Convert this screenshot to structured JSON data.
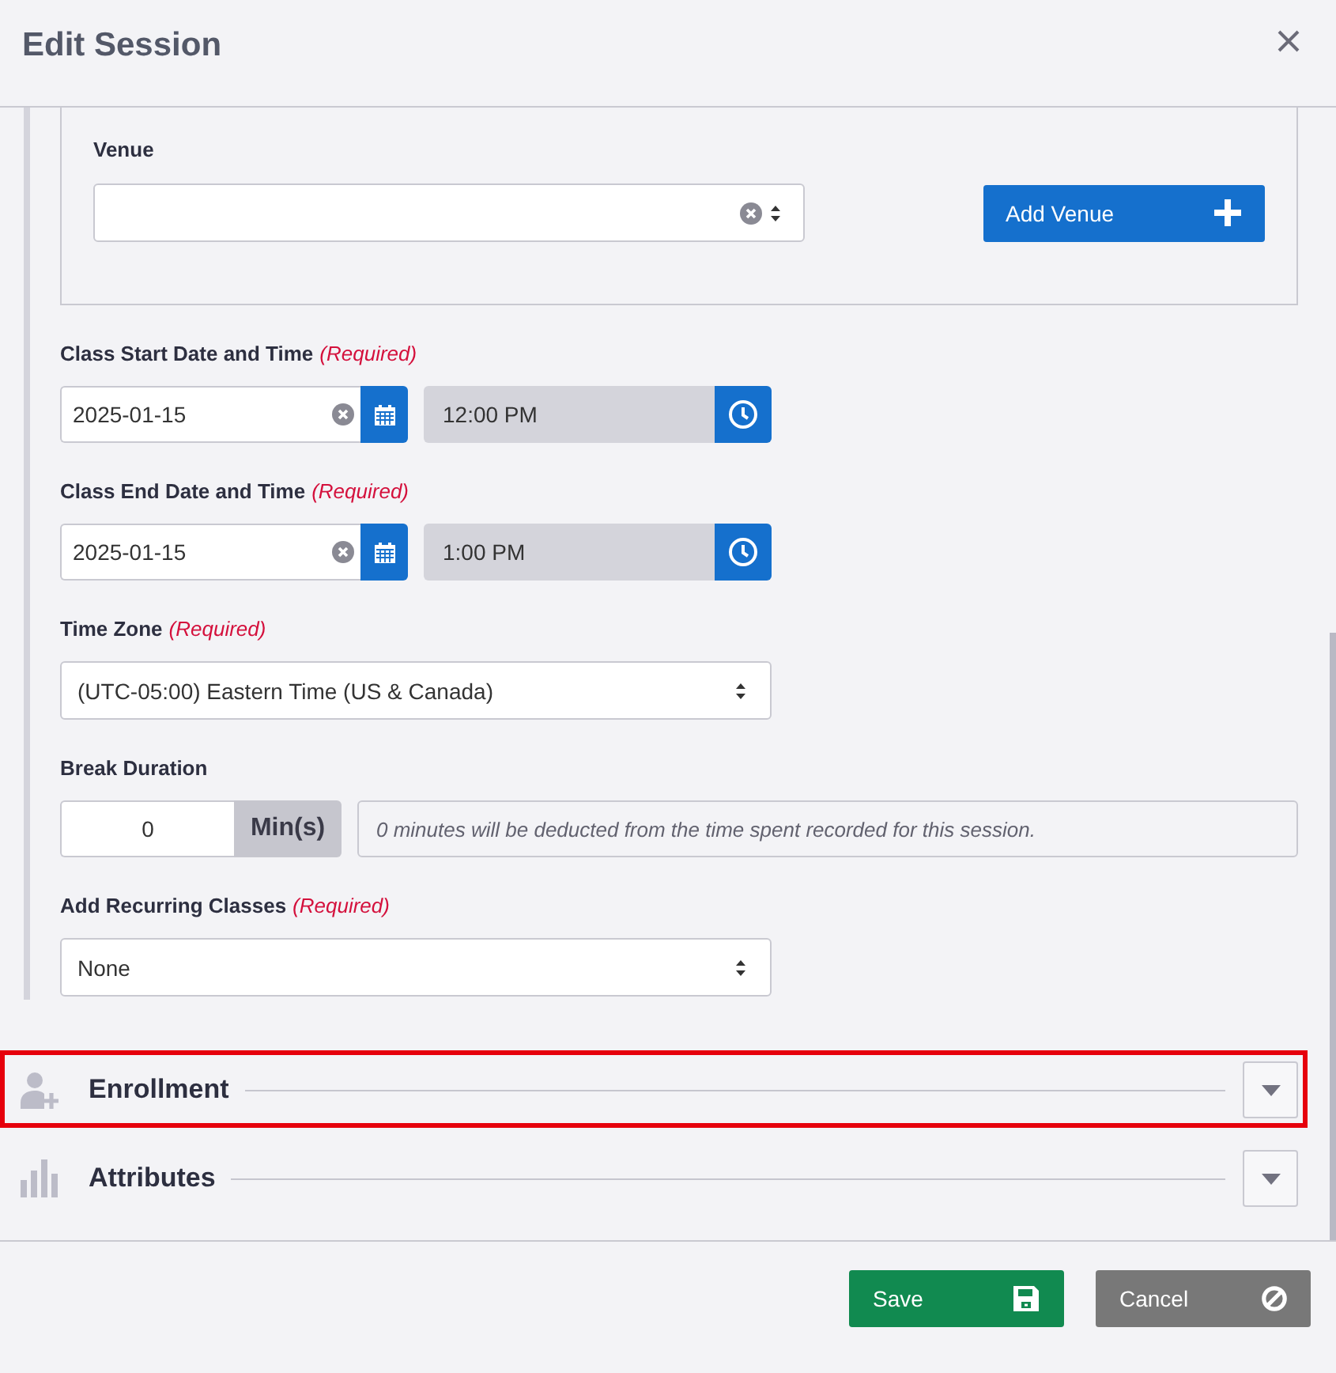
{
  "dialog": {
    "title": "Edit Session"
  },
  "venue": {
    "label": "Venue",
    "add_button": "Add Venue"
  },
  "fields": [
    {
      "kind": "datetime",
      "label": "Class Start Date and Time",
      "note": "(Required)",
      "date": "2025-01-15",
      "time": "12:00 PM",
      "time_readonly": true
    },
    {
      "kind": "datetime",
      "label": "Class End Date and Time",
      "note": "(Required)",
      "date": "2025-01-15",
      "time": "1:00 PM",
      "time_readonly": true
    },
    {
      "kind": "select",
      "label": "Time Zone",
      "note": "(Required)",
      "value": "(UTC-05:00) Eastern Time (US & Canada)"
    },
    {
      "kind": "duration",
      "label": "Break Duration",
      "value": "0",
      "unit": "Min(s)",
      "hint": "0 minutes will be deducted from the time spent recorded for this session."
    },
    {
      "kind": "select",
      "label": "Add Recurring Classes",
      "note": "(Required)",
      "value": "None"
    }
  ],
  "sections": [
    {
      "kind": "enrollment",
      "title": "Enrollment",
      "expanded": false,
      "highlighted": true
    },
    {
      "kind": "attributes",
      "title": "Attributes",
      "expanded": false,
      "highlighted": false
    }
  ],
  "footer": {
    "buttons": [
      {
        "kind": "save",
        "label": "Save"
      },
      {
        "kind": "cancel",
        "label": "Cancel"
      }
    ]
  }
}
